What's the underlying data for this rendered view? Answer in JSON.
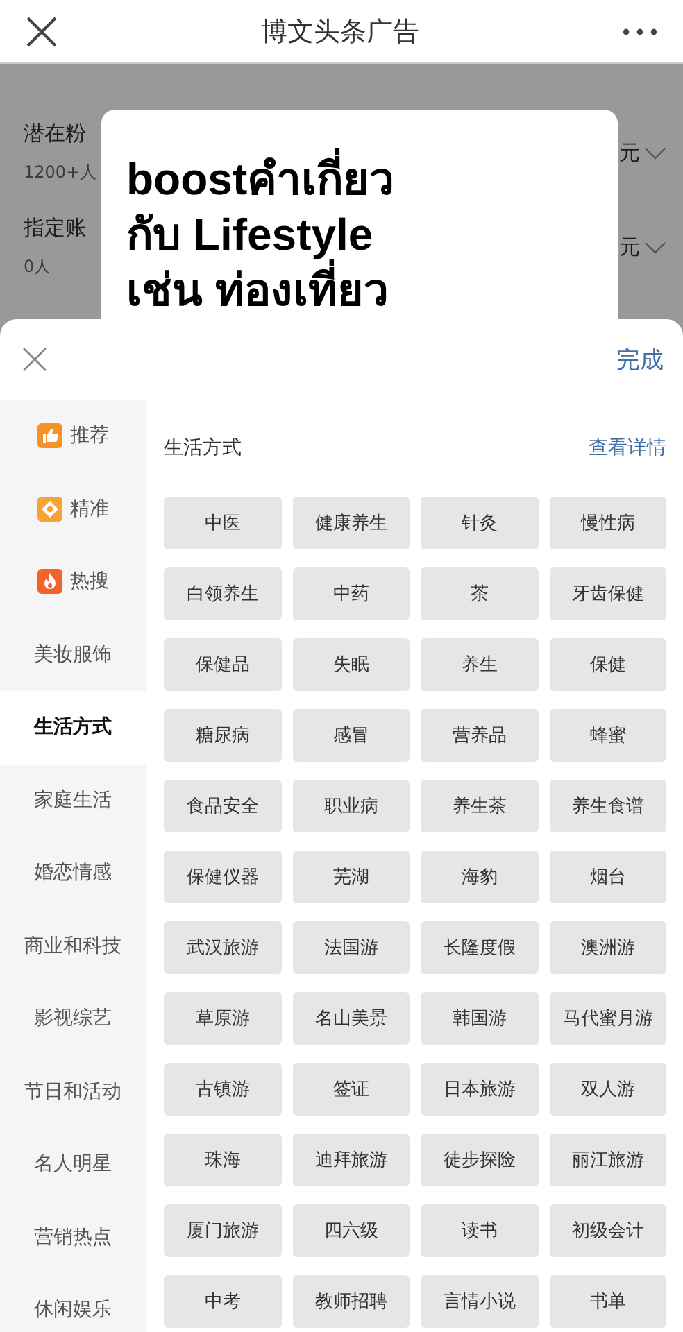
{
  "header": {
    "title": "博文头条广告"
  },
  "background_page": {
    "rows": [
      {
        "label": "潜在粉",
        "sub": "1200+人",
        "value": "元"
      },
      {
        "label": "指定账",
        "sub": "0人",
        "value": "元"
      }
    ]
  },
  "callout": {
    "lines": [
      "boostคำเกี่ยว",
      "กับ Lifestyle",
      "เช่น ท่องเที่ยว"
    ]
  },
  "sheet": {
    "done": "完成",
    "categories": [
      {
        "label": "推荐",
        "kind": "thumb",
        "selected": false
      },
      {
        "label": "精准",
        "kind": "target",
        "selected": false
      },
      {
        "label": "热搜",
        "kind": "fire",
        "selected": false
      },
      {
        "label": "美妆服饰",
        "kind": "plain",
        "selected": false
      },
      {
        "label": "生活方式",
        "kind": "plain",
        "selected": true
      },
      {
        "label": "家庭生活",
        "kind": "plain",
        "selected": false
      },
      {
        "label": "婚恋情感",
        "kind": "plain",
        "selected": false
      },
      {
        "label": "商业和科技",
        "kind": "plain",
        "selected": false
      },
      {
        "label": "影视综艺",
        "kind": "plain",
        "selected": false
      },
      {
        "label": "节日和活动",
        "kind": "plain",
        "selected": false
      },
      {
        "label": "名人明星",
        "kind": "plain",
        "selected": false
      },
      {
        "label": "营销热点",
        "kind": "plain",
        "selected": false
      },
      {
        "label": "休闲娱乐",
        "kind": "plain",
        "selected": false
      }
    ],
    "section": {
      "title": "生活方式",
      "link": "查看详情",
      "tags": [
        "中医",
        "健康养生",
        "针灸",
        "慢性病",
        "白领养生",
        "中药",
        "茶",
        "牙齿保健",
        "保健品",
        "失眠",
        "养生",
        "保健",
        "糖尿病",
        "感冒",
        "营养品",
        "蜂蜜",
        "食品安全",
        "职业病",
        "养生茶",
        "养生食谱",
        "保健仪器",
        "芜湖",
        "海豹",
        "烟台",
        "武汉旅游",
        "法国游",
        "长隆度假",
        "澳洲游",
        "草原游",
        "名山美景",
        "韩国游",
        "马代蜜月游",
        "古镇游",
        "签证",
        "日本旅游",
        "双人游",
        "珠海",
        "迪拜旅游",
        "徒步探险",
        "丽江旅游",
        "厦门旅游",
        "四六级",
        "读书",
        "初级会计",
        "中考",
        "教师招聘",
        "言情小说",
        "书单"
      ]
    }
  }
}
